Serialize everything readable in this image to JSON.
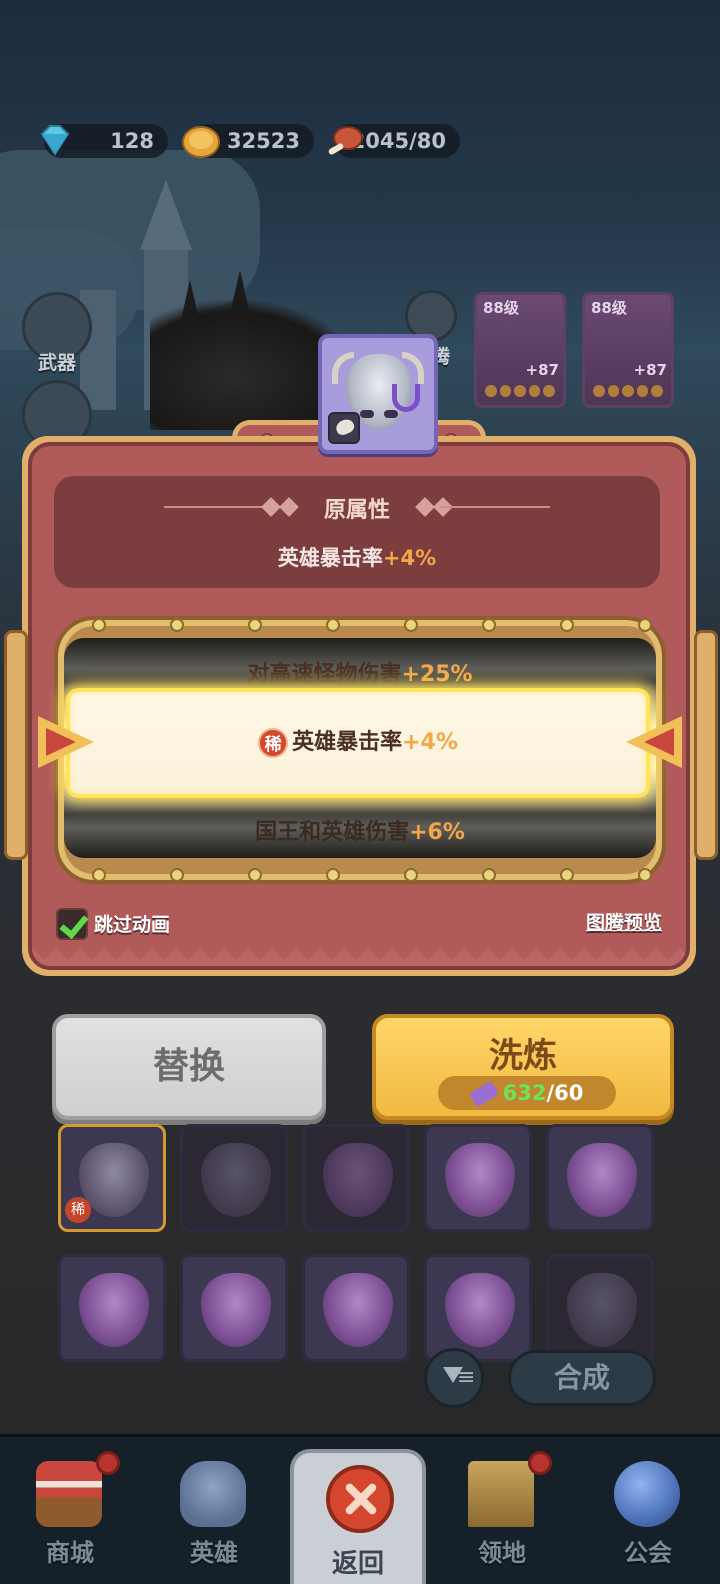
{
  "resources": {
    "gems": "128",
    "gold": "32523",
    "stamina": "2045/80"
  },
  "side_menu": {
    "weapon_label": "武器",
    "totem_label": "图腾"
  },
  "hero_cards": [
    {
      "level": "88级",
      "bonus": "+87"
    },
    {
      "level": "88级",
      "bonus": "+87"
    }
  ],
  "dialog": {
    "original_title": "原属性",
    "original_stat_name": "英雄暴击率",
    "original_stat_value": "+4%",
    "reel": [
      {
        "name": "对高速怪物伤害",
        "value": "+25%"
      },
      {
        "name": "英雄暴击率",
        "value": "+4%",
        "rarity": "稀",
        "selected": true
      },
      {
        "name": "国王和英雄伤害",
        "value": "+6%"
      }
    ],
    "skip_animation_label": "跳过动画",
    "skip_animation_checked": true,
    "preview_link": "图腾预览"
  },
  "actions": {
    "replace_label": "替换",
    "refine_label": "洗炼",
    "refine_cost_have": "632",
    "refine_cost_need": "/60"
  },
  "inventory": {
    "rare_badge": "稀"
  },
  "compose_label": "合成",
  "bottom_nav": {
    "shop": "商城",
    "hero": "英雄",
    "back": "返回",
    "territory": "领地",
    "guild": "公会"
  }
}
